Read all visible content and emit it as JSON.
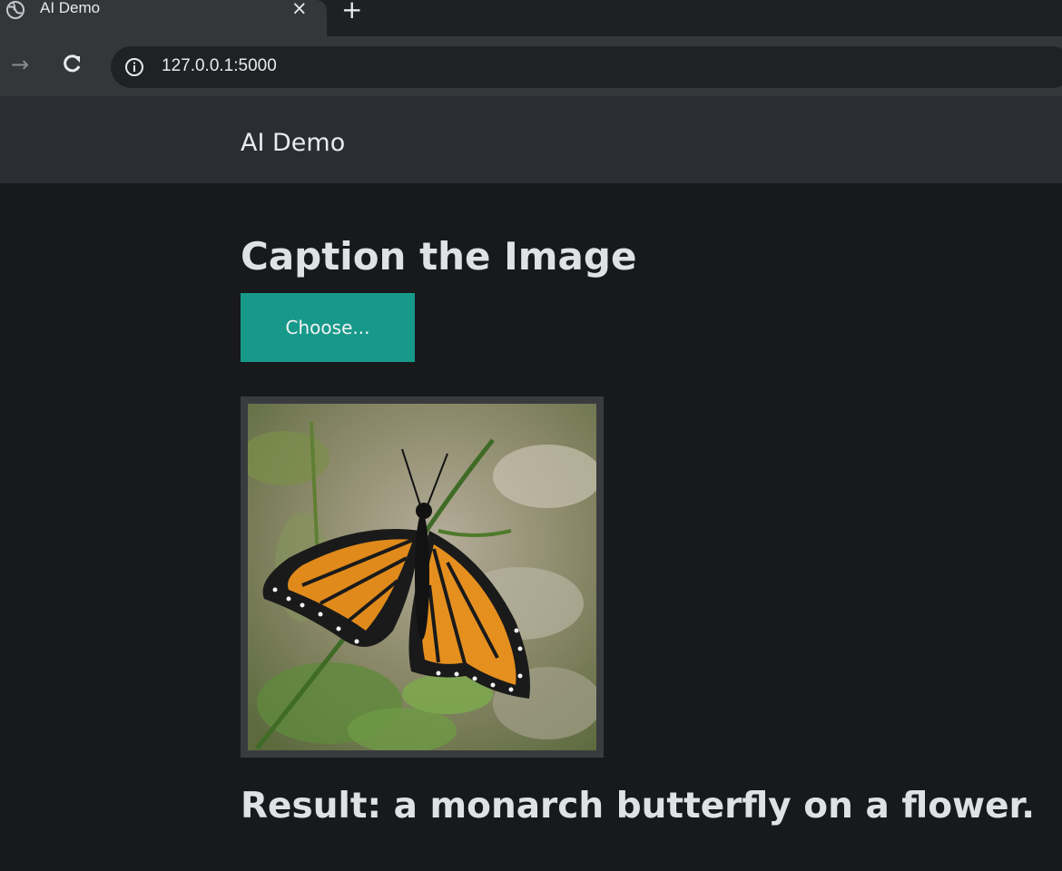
{
  "browser": {
    "tab_title": "AI Demo",
    "tab_icon": "globe-icon",
    "close_glyph": "×",
    "new_tab_glyph": "+",
    "url": "127.0.0.1:5000"
  },
  "navbar": {
    "brand": "AI Demo"
  },
  "main": {
    "heading": "Caption the Image",
    "choose_button_label": "Choose...",
    "result_text": "Result: a monarch butterfly on a flower."
  },
  "colors": {
    "background": "#18191b",
    "navbar": "#2a2d31",
    "accent_button": "#17998a"
  }
}
